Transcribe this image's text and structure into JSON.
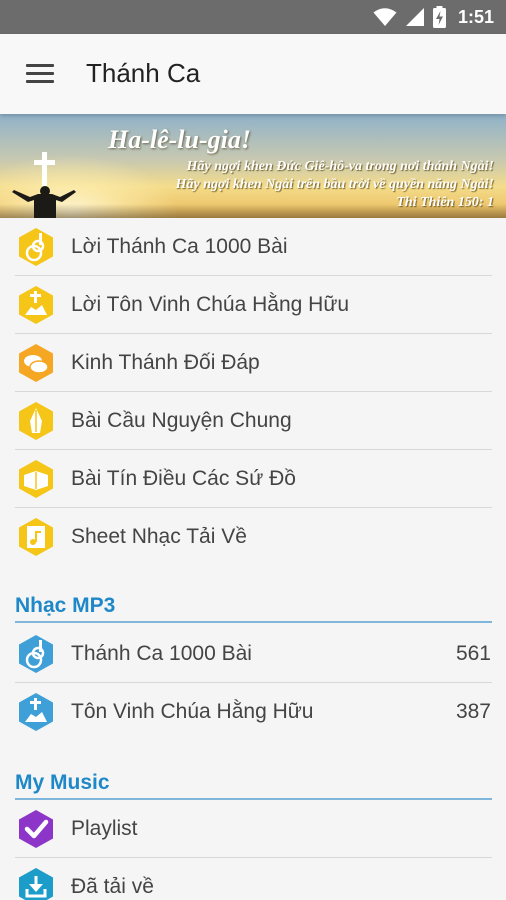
{
  "status_bar": {
    "time": "1:51",
    "icons": [
      "wifi-icon",
      "signal-icon",
      "battery-charging-icon"
    ]
  },
  "app_bar": {
    "title": "Thánh Ca",
    "menu_icon": "hamburger-menu-icon"
  },
  "banner": {
    "heading": "Ha-lê-lu-gia!",
    "line1": "Hãy ngợi khen Đức Giê-hô-va trong nơi thánh Ngài!",
    "line2": "Hãy ngợi khen Ngài trên bầu trời về quyền năng Ngài!",
    "reference": "Thi Thiên 150: 1"
  },
  "colors": {
    "accent_blue": "#1e88c8",
    "icon_yellow": "#f5c518",
    "icon_blue": "#3fa0d8",
    "icon_purple": "#8e35c9",
    "icon_teal": "#1b9cc9"
  },
  "main_menu": {
    "items": [
      {
        "label": "Lời Thánh Ca 1000 Bài",
        "icon": "guitar-icon"
      },
      {
        "label": "Lời Tôn Vinh Chúa Hằng Hữu",
        "icon": "worship-cross-icon"
      },
      {
        "label": "Kinh Thánh Đối Đáp",
        "icon": "speech-bubbles-icon"
      },
      {
        "label": "Bài Cầu Nguyện Chung",
        "icon": "praying-hands-icon"
      },
      {
        "label": "Bài Tín Điều Các Sứ Đồ",
        "icon": "open-book-icon"
      },
      {
        "label": "Sheet Nhạc Tải Về",
        "icon": "music-sheet-icon"
      }
    ]
  },
  "mp3_section": {
    "title": "Nhạc MP3",
    "items": [
      {
        "label": "Thánh Ca 1000 Bài",
        "count": "561",
        "icon": "guitar-icon"
      },
      {
        "label": "Tôn Vinh Chúa Hằng Hữu",
        "count": "387",
        "icon": "worship-cross-icon"
      }
    ]
  },
  "my_music_section": {
    "title": "My Music",
    "items": [
      {
        "label": "Playlist",
        "icon": "checkmark-icon"
      },
      {
        "label": "Đã tải về",
        "icon": "download-icon"
      }
    ]
  }
}
